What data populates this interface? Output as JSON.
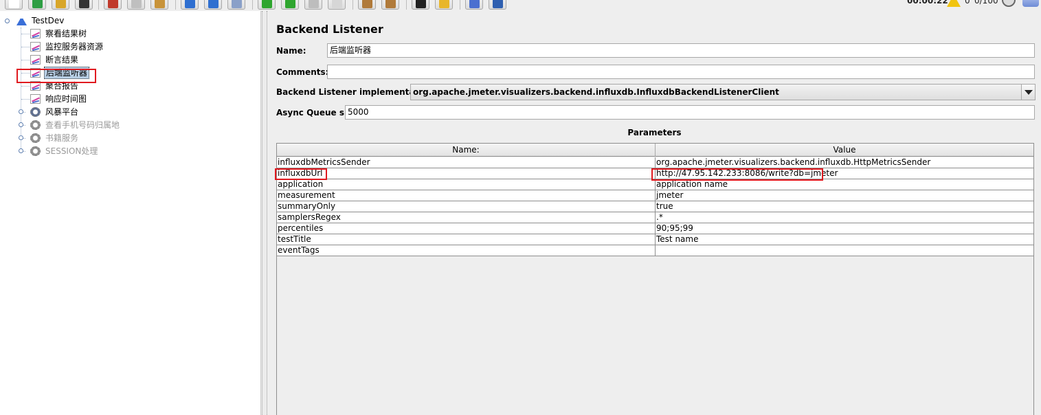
{
  "toolbar": {
    "buttons": [
      {
        "name": "new-icon",
        "color": "#ffffff"
      },
      {
        "name": "templates-icon",
        "color": "#2e9e44"
      },
      {
        "name": "open-icon",
        "color": "#d8a62a"
      },
      {
        "name": "save-icon",
        "color": "#333333"
      },
      {
        "name": "cut-icon",
        "color": "#c0392b"
      },
      {
        "name": "copy-icon",
        "color": "#bfbfbf"
      },
      {
        "name": "paste-icon",
        "color": "#c8933a"
      },
      {
        "name": "expand-icon",
        "color": "#2f6fd0"
      },
      {
        "name": "collapse-icon",
        "color": "#2f6fd0"
      },
      {
        "name": "toggle-icon",
        "color": "#8aa0c8"
      },
      {
        "name": "start-icon",
        "color": "#2fa52f"
      },
      {
        "name": "start-no-pauses-icon",
        "color": "#2fa52f"
      },
      {
        "name": "stop-icon",
        "color": "#bdbdbd"
      },
      {
        "name": "shutdown-icon",
        "color": "#d6d6d6"
      },
      {
        "name": "clear-icon",
        "color": "#b07a3a"
      },
      {
        "name": "clear-all-icon",
        "color": "#b07a3a"
      },
      {
        "name": "search-icon",
        "color": "#222222"
      },
      {
        "name": "reset-search-icon",
        "color": "#e8b62a"
      },
      {
        "name": "function-helper-icon",
        "color": "#4a6fd0"
      },
      {
        "name": "help-icon",
        "color": "#2f5fb0"
      }
    ],
    "timer": "00:00:22",
    "warning_count": "0",
    "threads": "0/100"
  },
  "tree": {
    "root": "TestDev",
    "items": [
      {
        "label": "察看结果树",
        "kind": "listener",
        "state": "normal"
      },
      {
        "label": "监控服务器资源",
        "kind": "listener",
        "state": "normal"
      },
      {
        "label": "断言结果",
        "kind": "listener",
        "state": "normal"
      },
      {
        "label": "后端监听器",
        "kind": "listener",
        "state": "selected"
      },
      {
        "label": "聚合报告",
        "kind": "listener",
        "state": "normal"
      },
      {
        "label": "响应时间图",
        "kind": "listener",
        "state": "normal"
      },
      {
        "label": "风暴平台",
        "kind": "threadgroup",
        "state": "normal"
      },
      {
        "label": "查看手机号码归属地",
        "kind": "threadgroup",
        "state": "disabled"
      },
      {
        "label": "书籍服务",
        "kind": "threadgroup",
        "state": "disabled"
      },
      {
        "label": "SESSION处理",
        "kind": "threadgroup",
        "state": "disabled"
      }
    ]
  },
  "panel": {
    "title": "Backend Listener",
    "name_label": "Name:",
    "name_value": "后端监听器",
    "comments_label": "Comments:",
    "comments_value": "",
    "impl_label": "Backend Listener implementation",
    "impl_value": "org.apache.jmeter.visualizers.backend.influxdb.InfluxdbBackendListenerClient",
    "queue_label": "Async Queue size",
    "queue_value": "5000"
  },
  "parameters": {
    "title": "Parameters",
    "columns": [
      "Name:",
      "Value"
    ],
    "rows": [
      [
        "influxdbMetricsSender",
        "org.apache.jmeter.visualizers.backend.influxdb.HttpMetricsSender"
      ],
      [
        "influxdbUrl",
        "http://47.95.142.233:8086/write?db=jmeter"
      ],
      [
        "application",
        "application name"
      ],
      [
        "measurement",
        "jmeter"
      ],
      [
        "summaryOnly",
        "true"
      ],
      [
        "samplersRegex",
        ".*"
      ],
      [
        "percentiles",
        "90;95;99"
      ],
      [
        "testTitle",
        "Test name"
      ],
      [
        "eventTags",
        ""
      ]
    ]
  },
  "highlight_color": "#e0191f"
}
